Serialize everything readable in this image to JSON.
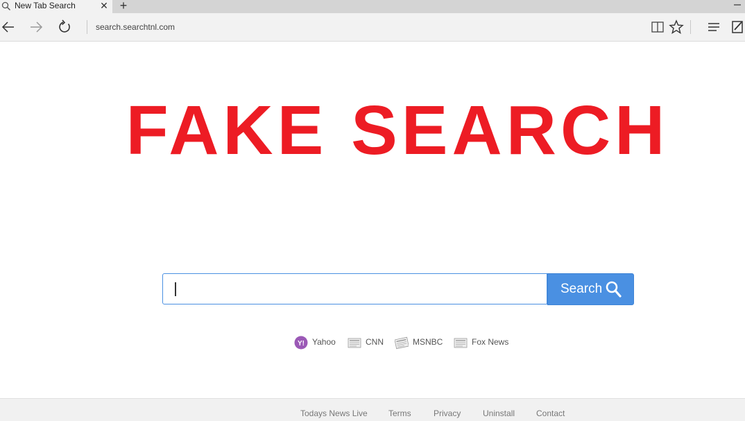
{
  "browser": {
    "tab_title": "New Tab Search",
    "address": "search.searchtnl.com"
  },
  "page": {
    "headline": "FAKE SEARCH",
    "search_placeholder": "",
    "search_button_label": "Search",
    "quick_links": [
      {
        "label": "Yahoo",
        "icon": "yahoo-icon"
      },
      {
        "label": "CNN",
        "icon": "newspaper-icon"
      },
      {
        "label": "MSNBC",
        "icon": "newspaper-icon"
      },
      {
        "label": "Fox News",
        "icon": "newspaper-icon"
      }
    ],
    "footer_links": [
      "Todays News Live",
      "Terms",
      "Privacy",
      "Uninstall",
      "Contact"
    ]
  },
  "colors": {
    "headline": "#ed1c24",
    "accent": "#4a90e2",
    "yahoo": "#9b59b6"
  }
}
